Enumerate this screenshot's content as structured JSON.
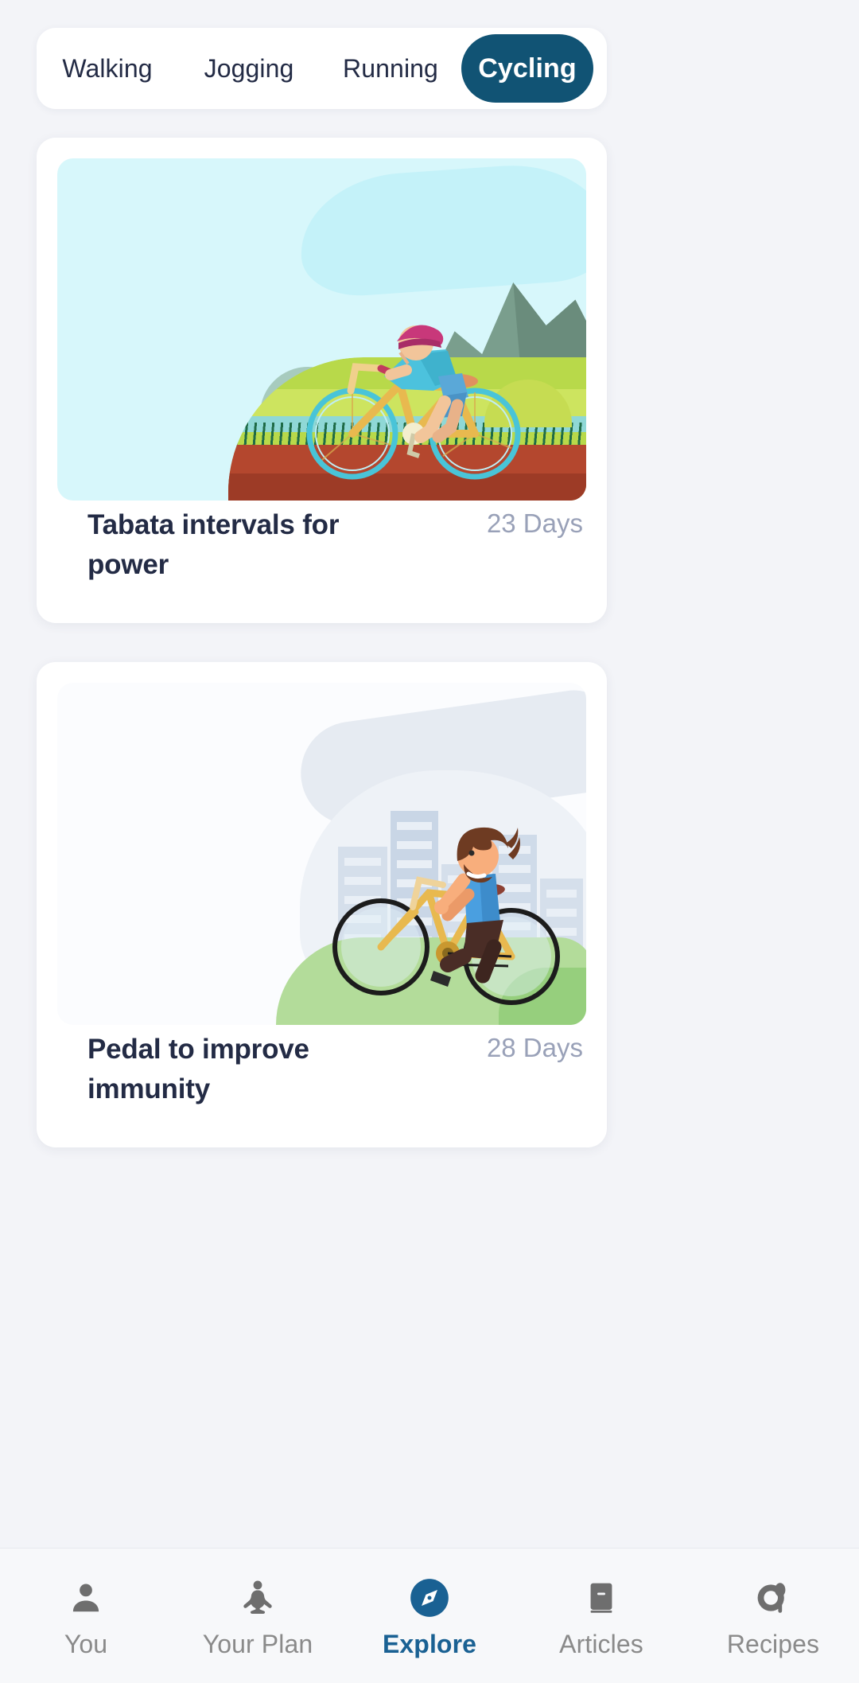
{
  "theme": {
    "page_bg": "#f3f4f8",
    "card_bg": "#ffffff",
    "accent": "#115374",
    "nav_active": "#1a6193",
    "title_color": "#232b45",
    "muted_color": "#99a1b8"
  },
  "category_tabs": {
    "items": [
      {
        "label": "Walking",
        "active": false
      },
      {
        "label": "Jogging",
        "active": false
      },
      {
        "label": "Running",
        "active": false
      },
      {
        "label": "Cycling",
        "active": true
      }
    ],
    "selected": "Cycling"
  },
  "workout_cards": [
    {
      "title": "Tabata intervals for power",
      "duration": "23 Days",
      "illustration": "cyclist-mountain-road"
    },
    {
      "title": "Pedal to improve immunity",
      "duration": "28 Days",
      "illustration": "cyclist-city-skyline"
    }
  ],
  "bottom_nav": {
    "items": [
      {
        "label": "You",
        "icon": "person-icon",
        "active": false
      },
      {
        "label": "Your Plan",
        "icon": "lotus-icon",
        "active": false
      },
      {
        "label": "Explore",
        "icon": "compass-icon",
        "active": true
      },
      {
        "label": "Articles",
        "icon": "book-icon",
        "active": false
      },
      {
        "label": "Recipes",
        "icon": "plate-spoon-icon",
        "active": false
      }
    ],
    "selected": "Explore"
  }
}
